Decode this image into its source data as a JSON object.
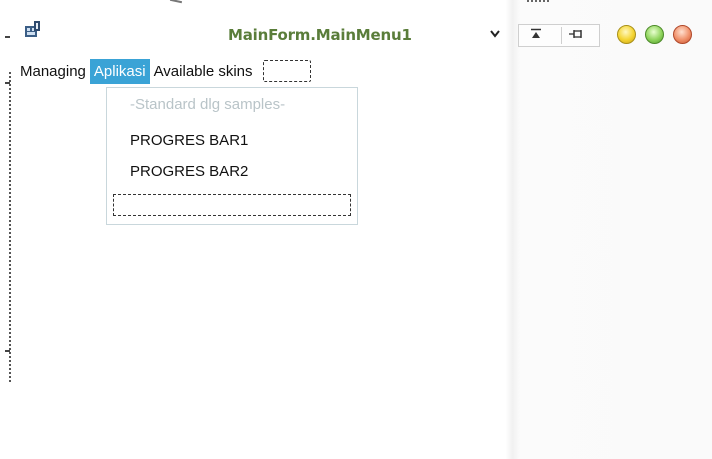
{
  "window": {
    "title": "MainForm.MainMenu1",
    "icon": "designer-form-icon",
    "buttons": {
      "dropdown": "chevron-down-icon",
      "minmax": "collapse-icon",
      "pin": "pin-icon"
    },
    "colors": {
      "minimize": "#f4d431",
      "maximize": "#8fd45c",
      "close": "#f0906a",
      "title": "#5a7d3a"
    }
  },
  "menubar": {
    "items": [
      {
        "label": "Managing"
      },
      {
        "label": "Aplikasi"
      },
      {
        "label": "Available skins"
      }
    ],
    "accent": "#3aa3d6"
  },
  "dropdown": {
    "items": [
      {
        "label": "-Standard dlg samples-"
      },
      {
        "label": "PROGRES BAR1"
      },
      {
        "label": "PROGRES BAR2"
      }
    ]
  }
}
